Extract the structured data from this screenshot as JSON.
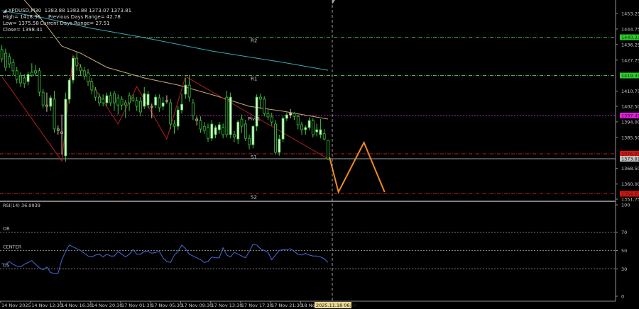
{
  "chart_data": {
    "type": "candlestick",
    "symbol_line": {
      "symbol": "XPDUSD,M30",
      "ohlc": "1383.88 1383.88 1373.07 1373.81"
    },
    "info": {
      "high": "High= 1418.36",
      "low": "Low= 1375.58",
      "close": "Close= 1398.41",
      "prev_range": "Previous Days Range= 42.78",
      "curr_range": "Current Days Range= 27.51"
    },
    "price_axis": {
      "ylim": [
        1350.97,
        1460.6
      ],
      "ticks": [
        "1453.25",
        "1444.75",
        "1436.25",
        "1427.75",
        "1410.75",
        "1402.50",
        "1394.00",
        "1385.50",
        "1368.50",
        "1360.00",
        "1351.75"
      ]
    },
    "levels": [
      {
        "name": "R2",
        "price": 1440.23,
        "label": "1440.23",
        "color": "#4caf50",
        "badge": "#2ecc2e"
      },
      {
        "name": "R1",
        "price": 1419.33,
        "label": "1419.33",
        "color": "#4caf50",
        "badge": "#2ecc2e"
      },
      {
        "name": "Pivot",
        "price": 1397.45,
        "label": "1397.45",
        "color": "#b030b0",
        "badge": "#e020e0"
      },
      {
        "name": "S1",
        "price": 1376.55,
        "label": "1376.55",
        "color": "#c02020",
        "badge": "#e01010"
      },
      {
        "name": "S2",
        "price": 1354.67,
        "label": "1354.67",
        "color": "#c02020",
        "badge": "#e01010"
      }
    ],
    "current_price": {
      "price": 1373.81,
      "label": "1373.81",
      "color": "#a0a0a0"
    },
    "candles": [
      [
        1433.5,
        1436,
        1426.5,
        1428.4
      ],
      [
        1431.5,
        1434,
        1421.8,
        1423.8
      ],
      [
        1429.6,
        1431.5,
        1423.5,
        1425.7
      ],
      [
        1426.5,
        1428.5,
        1419.5,
        1421.9
      ],
      [
        1421.9,
        1424,
        1415,
        1417.2
      ],
      [
        1419.1,
        1421,
        1413,
        1415.3
      ],
      [
        1418.0,
        1420,
        1412.5,
        1414.9
      ],
      [
        1416.0,
        1421.5,
        1414,
        1419.9
      ],
      [
        1421.1,
        1426,
        1418.5,
        1419.5
      ],
      [
        1421.9,
        1425,
        1419,
        1420.7
      ],
      [
        1421.9,
        1423.5,
        1408,
        1410.2
      ],
      [
        1410.2,
        1412,
        1401.5,
        1403.2
      ],
      [
        1403.2,
        1410,
        1399.5,
        1402.5
      ],
      [
        1402.5,
        1408.5,
        1400,
        1407.1
      ],
      [
        1406.4,
        1411,
        1388,
        1390.1
      ],
      [
        1390.1,
        1392,
        1387,
        1389.3
      ],
      [
        1388.5,
        1398,
        1376,
        1387.7
      ],
      [
        1375.4,
        1410,
        1372.2,
        1406.4
      ],
      [
        1406.4,
        1418,
        1404,
        1416.8
      ],
      [
        1416.8,
        1430,
        1415,
        1428.8
      ],
      [
        1428.8,
        1432,
        1422,
        1424.6
      ],
      [
        1423.8,
        1425.5,
        1419.5,
        1421.9
      ],
      [
        1421.9,
        1424,
        1417,
        1419.1
      ],
      [
        1420.7,
        1423,
        1413.5,
        1416.0
      ],
      [
        1416.0,
        1418,
        1409,
        1411.4
      ],
      [
        1411.4,
        1413,
        1405.5,
        1407.5
      ],
      [
        1407.5,
        1409.5,
        1402.5,
        1404.4
      ],
      [
        1406.4,
        1409,
        1402.5,
        1404.4
      ],
      [
        1404.4,
        1410,
        1402.5,
        1408.3
      ],
      [
        1408.3,
        1410.5,
        1402.5,
        1404.4
      ],
      [
        1409.4,
        1411,
        1400,
        1404.4
      ],
      [
        1407.1,
        1409,
        1398,
        1403.2
      ],
      [
        1406.4,
        1408,
        1400.5,
        1403.2
      ],
      [
        1404.4,
        1406,
        1396,
        1403.2
      ],
      [
        1408.3,
        1410,
        1400,
        1404.4
      ],
      [
        1407.1,
        1409,
        1405,
        1405.6
      ],
      [
        1405.6,
        1407.5,
        1400,
        1402.5
      ],
      [
        1405.2,
        1407.5,
        1397,
        1399.4
      ],
      [
        1402.5,
        1413,
        1401,
        1409.4
      ],
      [
        1403.2,
        1411,
        1401.5,
        1409.1
      ],
      [
        1402.5,
        1404,
        1396,
        1402.0
      ],
      [
        1403.2,
        1409,
        1401.5,
        1407.5
      ],
      [
        1407.1,
        1409,
        1399.5,
        1401.7
      ],
      [
        1402.5,
        1407.5,
        1400.5,
        1404.4
      ],
      [
        1405.6,
        1408.5,
        1404,
        1405.2
      ],
      [
        1404.4,
        1406.5,
        1390,
        1392.8
      ],
      [
        1392.8,
        1395,
        1387.5,
        1391.6
      ],
      [
        1391.6,
        1402.5,
        1389.5,
        1400.5
      ],
      [
        1400.5,
        1409.5,
        1398.5,
        1403.6
      ],
      [
        1409.1,
        1418,
        1406.5,
        1414.1
      ],
      [
        1414.1,
        1419.5,
        1405,
        1407.5
      ],
      [
        1404.4,
        1406.5,
        1395,
        1397.4
      ],
      [
        1395.5,
        1397,
        1392,
        1394.7
      ],
      [
        1394.7,
        1397,
        1388,
        1390.1
      ],
      [
        1391.6,
        1394,
        1387.5,
        1389.3
      ],
      [
        1390.9,
        1393,
        1383,
        1385.0
      ],
      [
        1385.0,
        1395,
        1383.5,
        1392.8
      ],
      [
        1387.0,
        1392,
        1385,
        1390.9
      ],
      [
        1389.7,
        1394,
        1387.5,
        1392.4
      ],
      [
        1390.9,
        1393,
        1385,
        1387.0
      ],
      [
        1407.5,
        1411,
        1385.5,
        1387.0
      ],
      [
        1387.0,
        1410,
        1385,
        1407.5
      ],
      [
        1387.0,
        1389,
        1383,
        1385.8
      ],
      [
        1384.6,
        1395,
        1382,
        1393.9
      ],
      [
        1395.5,
        1398,
        1388,
        1391.6
      ],
      [
        1392.8,
        1395,
        1383.5,
        1385.0
      ],
      [
        1385.0,
        1387,
        1379,
        1381.5
      ],
      [
        1381.5,
        1392,
        1379.5,
        1391.6
      ],
      [
        1391.6,
        1409,
        1389,
        1407.5
      ],
      [
        1407.5,
        1409.5,
        1401,
        1406.4
      ],
      [
        1406.4,
        1408,
        1397,
        1398.6
      ],
      [
        1398.6,
        1401,
        1395,
        1396.7
      ],
      [
        1396.7,
        1399,
        1392,
        1393.9
      ],
      [
        1392.8,
        1395,
        1376,
        1377.3
      ],
      [
        1377.3,
        1387,
        1375.5,
        1384.6
      ],
      [
        1384.6,
        1397,
        1383,
        1395.9
      ],
      [
        1395.9,
        1399,
        1394.5,
        1397.8
      ],
      [
        1397.8,
        1401,
        1396,
        1398.6
      ],
      [
        1398.6,
        1399.5,
        1395,
        1397.0
      ],
      [
        1397.0,
        1398,
        1390,
        1392.4
      ],
      [
        1392.4,
        1394,
        1387,
        1389.7
      ],
      [
        1389.7,
        1392,
        1387,
        1390.9
      ],
      [
        1390.9,
        1396.5,
        1389.5,
        1394.7
      ],
      [
        1394.7,
        1396,
        1385.5,
        1387.0
      ],
      [
        1388.5,
        1393,
        1386,
        1389.7
      ],
      [
        1387.0,
        1395.5,
        1385,
        1389.7
      ],
      [
        1387.5,
        1390,
        1384,
        1384.6
      ],
      [
        1383.88,
        1383.88,
        1373.07,
        1373.81
      ]
    ],
    "candle_colors": {
      "outline": "#3cc43c",
      "bull_fill": "#dcf8d4",
      "bear_fill": "#000000",
      "doji": "#d8c8a0"
    },
    "moving_averages": [
      {
        "color": "#3aa8b8",
        "points": [
          [
            0,
            1454.8
          ],
          [
            11,
            1450.9
          ],
          [
            24,
            1445.1
          ],
          [
            37,
            1440.4
          ],
          [
            56,
            1432.7
          ],
          [
            75,
            1426.5
          ],
          [
            87,
            1422.2
          ]
        ]
      },
      {
        "color": "#c8a878",
        "points": [
          [
            6,
            1460.6
          ],
          [
            11,
            1449.0
          ],
          [
            16,
            1435.4
          ],
          [
            21,
            1431.5
          ],
          [
            28,
            1423.8
          ],
          [
            38,
            1418.0
          ],
          [
            47,
            1414.1
          ],
          [
            57,
            1408.3
          ],
          [
            66,
            1402.5
          ],
          [
            75,
            1399.8
          ],
          [
            87,
            1395.5
          ]
        ]
      }
    ],
    "zigzag": {
      "color": "#b02020",
      "points": [
        [
          0,
          1418.8
        ],
        [
          16,
          1372.6
        ],
        [
          19,
          1430.4
        ],
        [
          31,
          1392.8
        ],
        [
          36,
          1413.3
        ],
        [
          44,
          1384.6
        ],
        [
          49,
          1418.8
        ],
        [
          87,
          1373.8
        ]
      ]
    },
    "forecast": {
      "color": "#f08a20",
      "points": [
        [
          87.4,
          1374.6
        ],
        [
          89.8,
          1355.6
        ],
        [
          96.6,
          1382.7
        ],
        [
          102.1,
          1355.6
        ]
      ]
    },
    "rsi": {
      "label": "RSI(14) 36.9939",
      "color": "#4a6ad8",
      "ylim": [
        0,
        100
      ],
      "ticks": [
        "100",
        "70",
        "50",
        "30",
        "0"
      ],
      "levels": [
        {
          "name": "OB",
          "value": 70
        },
        {
          "name": "CENTER",
          "value": 50
        },
        {
          "name": "OS",
          "value": 30
        }
      ],
      "values": [
        36,
        35,
        38,
        35,
        33,
        32,
        35,
        37,
        39,
        35,
        31,
        29,
        32,
        26,
        25,
        25,
        40,
        49,
        56,
        54,
        52,
        50,
        47,
        44,
        43,
        45,
        46,
        43,
        46,
        44,
        44,
        49,
        46,
        43,
        46,
        51,
        46,
        46,
        49,
        49,
        47,
        48,
        49,
        42,
        38,
        37,
        45,
        49,
        56,
        52,
        46,
        44,
        42,
        40,
        37,
        38,
        43,
        42,
        42,
        53,
        45,
        43,
        48,
        46,
        44,
        42,
        49,
        57,
        56,
        52,
        50,
        48,
        40,
        45,
        50,
        51,
        51,
        52,
        49,
        46,
        45,
        47,
        45,
        44,
        44,
        43,
        41,
        37
      ]
    },
    "time_axis": {
      "labels": [
        "14 Nov 2025",
        "14 Nov 12:30",
        "14 Nov 16:30",
        "14 Nov 20:30",
        "17 Nov 01:30",
        "17 Nov 05:30",
        "17 Nov 09:30",
        "17 Nov 13:30",
        "17 Nov 17:30",
        "17 Nov 21:30",
        "18 Nov"
      ],
      "cursor_label": "2025.11.18 06:30",
      "cursor_color": "#e8d890"
    }
  }
}
